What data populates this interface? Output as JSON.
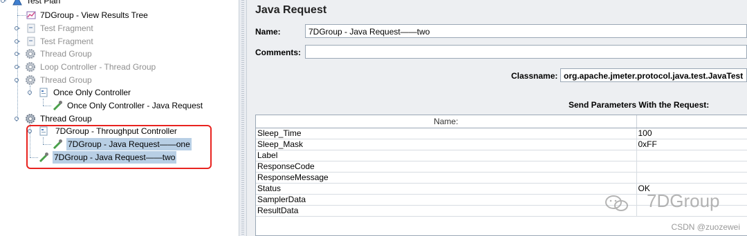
{
  "tree": {
    "root": "Test Plan",
    "nodes": [
      {
        "label": "7DGroup - View Results Tree",
        "icon": "chart-icon",
        "enabled": true
      },
      {
        "label": "Test Fragment",
        "icon": "fragment-icon",
        "enabled": false
      },
      {
        "label": "Test Fragment",
        "icon": "fragment-icon",
        "enabled": false
      },
      {
        "label": "Thread Group",
        "icon": "gear-icon",
        "enabled": false
      },
      {
        "label": "Loop Controller - Thread Group",
        "icon": "gear-icon",
        "enabled": false
      },
      {
        "label": "Thread Group",
        "icon": "gear-icon",
        "enabled": false
      },
      {
        "label": "Once Only Controller",
        "icon": "controller-icon",
        "enabled": true
      },
      {
        "label": "Once Only Controller - Java Request",
        "icon": "sampler-icon",
        "enabled": true
      },
      {
        "label": "Thread Group",
        "icon": "gear-icon",
        "enabled": true
      },
      {
        "label": "7DGroup - Throughput Controller",
        "icon": "controller-icon",
        "enabled": true
      },
      {
        "label": "7DGroup - Java Request——one",
        "icon": "sampler-icon",
        "enabled": true,
        "selected": true
      },
      {
        "label": "7DGroup - Java Request——two",
        "icon": "sampler-icon",
        "enabled": true,
        "selected": true
      }
    ]
  },
  "panel": {
    "title": "Java Request",
    "name_label": "Name:",
    "name_value": "7DGroup - Java Request——two",
    "comments_label": "Comments:",
    "comments_value": "",
    "classname_label": "Classname:",
    "classname_value": "org.apache.jmeter.protocol.java.test.JavaTest",
    "params_title": "Send Parameters With the Request:",
    "table_headers": [
      "Name:",
      ""
    ],
    "rows": [
      {
        "name": "Sleep_Time",
        "value": "100"
      },
      {
        "name": "Sleep_Mask",
        "value": "0xFF"
      },
      {
        "name": "Label",
        "value": ""
      },
      {
        "name": "ResponseCode",
        "value": ""
      },
      {
        "name": "ResponseMessage",
        "value": ""
      },
      {
        "name": "Status",
        "value": "OK"
      },
      {
        "name": "SamplerData",
        "value": ""
      },
      {
        "name": "ResultData",
        "value": ""
      }
    ]
  },
  "watermark": "7DGroup",
  "credit": "CSDN @zuozewei",
  "colors": {
    "selection": "#b8cfe5",
    "highlight_box": "#e8231f",
    "panel_bg": "#edeff2"
  }
}
